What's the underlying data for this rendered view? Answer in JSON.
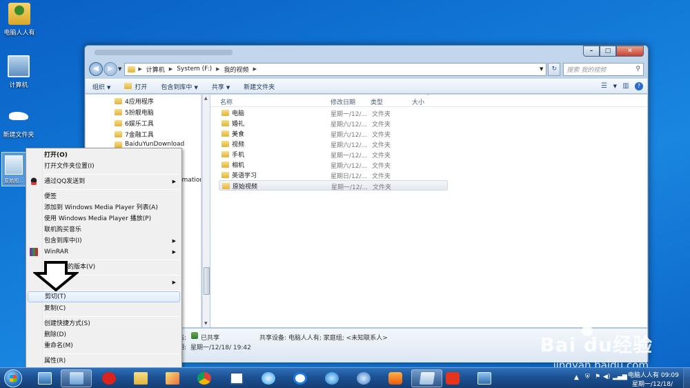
{
  "desktop": {
    "icons": [
      {
        "label": "电脑人人有"
      },
      {
        "label": "计算机"
      },
      {
        "label": "新建文件夹"
      },
      {
        "label": "原始视..."
      }
    ]
  },
  "window": {
    "address": {
      "segments": [
        "计算机",
        "System (F:)",
        "我的视频"
      ],
      "search_placeholder": "搜索 我的视频"
    },
    "toolbar": {
      "organize": "组织",
      "open": "打开",
      "include_in_library": "包含到库中",
      "share": "共享",
      "new_folder": "新建文件夹"
    },
    "nav_items": [
      "4应用程序",
      "5扮靓电脑",
      "6娱乐工具",
      "7金融工具",
      "BaiduYunDownload",
      "rmation"
    ],
    "columns": {
      "name": "名称",
      "date": "修改日期",
      "type": "类型",
      "size": "大小"
    },
    "files": [
      {
        "name": "电脑",
        "date": "星期一/12/...",
        "type": "文件夹"
      },
      {
        "name": "婚礼",
        "date": "星期六/12/...",
        "type": "文件夹"
      },
      {
        "name": "美食",
        "date": "星期六/12/...",
        "type": "文件夹"
      },
      {
        "name": "视频",
        "date": "星期六/12/...",
        "type": "文件夹"
      },
      {
        "name": "手机",
        "date": "星期一/12/...",
        "type": "文件夹"
      },
      {
        "name": "相机",
        "date": "星期六/12/...",
        "type": "文件夹"
      },
      {
        "name": "英语学习",
        "date": "星期日/12/...",
        "type": "文件夹"
      },
      {
        "name": "原始视频",
        "date": "星期一/12/...",
        "type": "文件夹"
      }
    ],
    "details": {
      "share_state_label": "态:",
      "share_state": "已共享",
      "date_label": "期:",
      "date_value": "星期一/12/18/ 19:42",
      "shared_with": "共享设备: 电脑人人有; 家庭组; <未知联系人>"
    }
  },
  "context_menu": {
    "items": [
      {
        "label": "打开(O)"
      },
      {
        "label": "打开文件夹位置(I)"
      },
      {
        "label": "通过QQ发送到"
      },
      {
        "label": "便签"
      },
      {
        "label": "添加到 Windows Media Player 列表(A)"
      },
      {
        "label": "使用 Windows Media Player 播放(P)"
      },
      {
        "label": "联机购买音乐"
      },
      {
        "label": "包含到库中(I)"
      },
      {
        "label": "WinRAR"
      },
      {
        "label": "的版本(V)"
      },
      {
        "label": ""
      },
      {
        "label": "剪切(T)"
      },
      {
        "label": "复制(C)"
      },
      {
        "label": "创建快捷方式(S)"
      },
      {
        "label": "删除(D)"
      },
      {
        "label": "重命名(M)"
      },
      {
        "label": "属性(R)"
      }
    ]
  },
  "watermark": {
    "brand": "Bai du经验",
    "url": "jingyan.baidu.com"
  },
  "taskbar": {
    "clock_line1": "电脑人人有 09:09",
    "clock_line2": "星期一/12/18/"
  },
  "colors": {
    "desktop": "#1177d6",
    "taskbar": "#1b4f8f",
    "highlight": "#dfeafb"
  }
}
